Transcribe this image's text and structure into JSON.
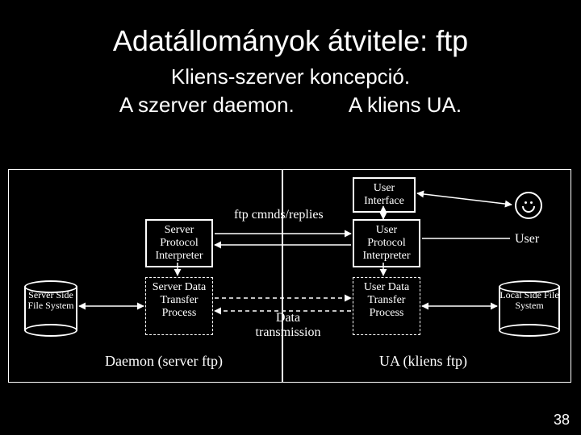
{
  "title": "Adatállományok átvitele: ftp",
  "subtitle": "Kliens-szerver koncepció.",
  "line2_left": "A szerver daemon.",
  "line2_right": "A kliens UA.",
  "labels": {
    "ftp_cmnds": "ftp cmnds/replies",
    "data_trans": "Data transmission",
    "daemon": "Daemon (server ftp)",
    "ua": "UA (kliens ftp)",
    "user": "User"
  },
  "boxes": {
    "ui": "User Interface",
    "spi": "Server Protocol Interpreter",
    "upi": "User Protocol Interpreter",
    "sdtp": "Server Data Transfer Process",
    "udtp": "User Data Transfer Process",
    "ssfs": "Server Side File System",
    "lsfs": "Local Side File System"
  },
  "page": "38"
}
